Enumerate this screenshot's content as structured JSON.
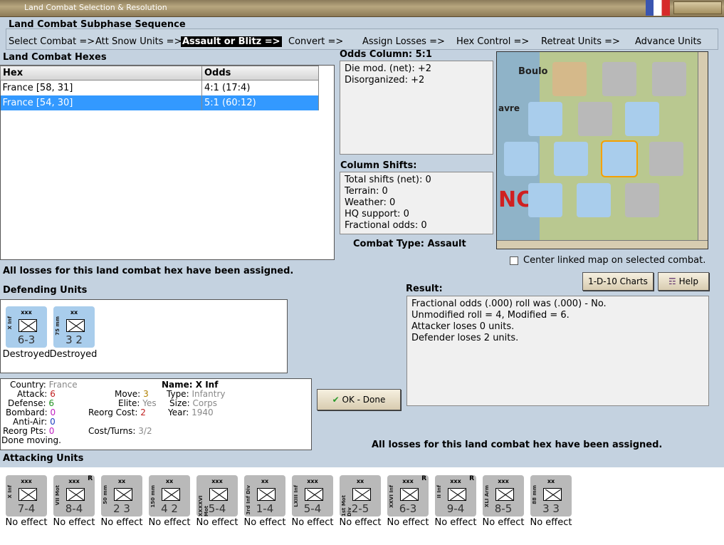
{
  "window": {
    "title": "Land Combat Selection & Resolution"
  },
  "sequence": {
    "heading": "Land Combat Subphase Sequence",
    "steps": [
      "Select Combat =>",
      "Att Snow Units =>",
      "Assault or Blitz =>",
      "Convert =>",
      "Assign Losses =>",
      "Hex Control =>",
      "Retreat Units =>",
      "Advance Units"
    ],
    "selected_index": 2
  },
  "hexes": {
    "heading": "Land Combat Hexes",
    "columns": [
      "Hex",
      "Odds"
    ],
    "rows": [
      {
        "hex": "France [58, 31]",
        "odds": "4:1 (17:4)"
      },
      {
        "hex": "France [54, 30]",
        "odds": "5:1 (60:12)"
      }
    ],
    "selected_row": 1
  },
  "odds": {
    "heading": "Odds Column: 5:1",
    "lines": [
      "Die mod. (net): +2",
      "Disorganized: +2"
    ]
  },
  "shifts": {
    "heading": "Column Shifts:",
    "lines": [
      "Total shifts (net): 0",
      "Terrain: 0",
      "Weather: 0",
      "HQ support: 0",
      "Fractional odds: 0"
    ]
  },
  "combat_type": "Combat Type:  Assault",
  "map": {
    "center_label": "Center linked map on selected combat.",
    "places": [
      "Boulo",
      "avre",
      "NC"
    ]
  },
  "buttons": {
    "charts": "1-D-10 Charts",
    "help": "Help",
    "ok": "OK - Done"
  },
  "losses_msg": "All losses for this land combat hex have been assigned.",
  "defending": {
    "heading": "Defending Units",
    "units": [
      {
        "size": "xxx",
        "name": "X Inf",
        "str": "6-3",
        "status": "Destroyed",
        "icon": "infantry-icon"
      },
      {
        "size": "xx",
        "name": "75 mm",
        "str": "3 2",
        "status": "Destroyed",
        "icon": "artillery-icon"
      }
    ]
  },
  "result": {
    "heading": "Result:",
    "lines": [
      "Fractional odds (.000) roll was (.000)  - No.",
      "Unmodified roll = 4, Modified = 6.",
      "Attacker loses 0 units.",
      "Defender loses 2 units."
    ]
  },
  "unit_info": {
    "country_label": "Country:",
    "country": "France",
    "attack_label": "Attack:",
    "attack": "6",
    "defense_label": "Defense:",
    "defense": "6",
    "bombard_label": "Bombard:",
    "bombard": "0",
    "antiair_label": "Anti-Air:",
    "antiair": "0",
    "reorg_label": "Reorg Pts:",
    "reorg": "0",
    "done": "Done moving.",
    "move_label": "Move:",
    "move": "3",
    "elite_label": "Elite:",
    "elite": "Yes",
    "reorg_cost_label": "Reorg Cost:",
    "reorg_cost": "2",
    "cost_turns_label": "Cost/Turns:",
    "cost_turns": "3/2",
    "name_label": "Name:",
    "name": "X Inf",
    "type_label": "Type:",
    "type": "Infantry",
    "size_label": "Size:",
    "size": "Corps",
    "year_label": "Year:",
    "year": "1940"
  },
  "bottom_msg": "All losses for this land combat hex have been assigned.",
  "attacking": {
    "heading": "Attacking Units",
    "units": [
      {
        "size": "xxx",
        "name": "X Inf",
        "str": "7-4",
        "status": "No effect",
        "r": ""
      },
      {
        "size": "xxx",
        "name": "VII Mot",
        "str": "8-4",
        "status": "No effect",
        "r": "R"
      },
      {
        "size": "xx",
        "name": "50 mm",
        "str": "2 3",
        "status": "No effect",
        "r": ""
      },
      {
        "size": "xx",
        "name": "150 mm",
        "str": "4 2",
        "status": "No effect",
        "r": ""
      },
      {
        "size": "xxx",
        "name": "XXXXVI Mot",
        "str": "5-4",
        "status": "No effect",
        "r": ""
      },
      {
        "size": "xx",
        "name": "3rd Inf Div",
        "str": "1-4",
        "status": "No effect",
        "r": ""
      },
      {
        "size": "xxx",
        "name": "LXIII Inf",
        "str": "5-4",
        "status": "No effect",
        "r": ""
      },
      {
        "size": "xx",
        "name": "1st Mot Div",
        "str": "2-5",
        "status": "No effect",
        "r": ""
      },
      {
        "size": "xxx",
        "name": "XXVI Inf",
        "str": "6-3",
        "status": "No effect",
        "r": "R"
      },
      {
        "size": "xxx",
        "name": "II Inf",
        "str": "9-4",
        "status": "No effect",
        "r": "R"
      },
      {
        "size": "xxx",
        "name": "XLI Arm",
        "str": "8-5",
        "status": "No effect",
        "r": ""
      },
      {
        "size": "xx",
        "name": "88 mm",
        "str": "3 3",
        "status": "No effect",
        "r": ""
      }
    ]
  },
  "colors": {
    "panel_bg": "#c4d2e0",
    "selected": "#3399ff",
    "german_counter": "#b9b9b9",
    "french_counter": "#a9cdec"
  }
}
